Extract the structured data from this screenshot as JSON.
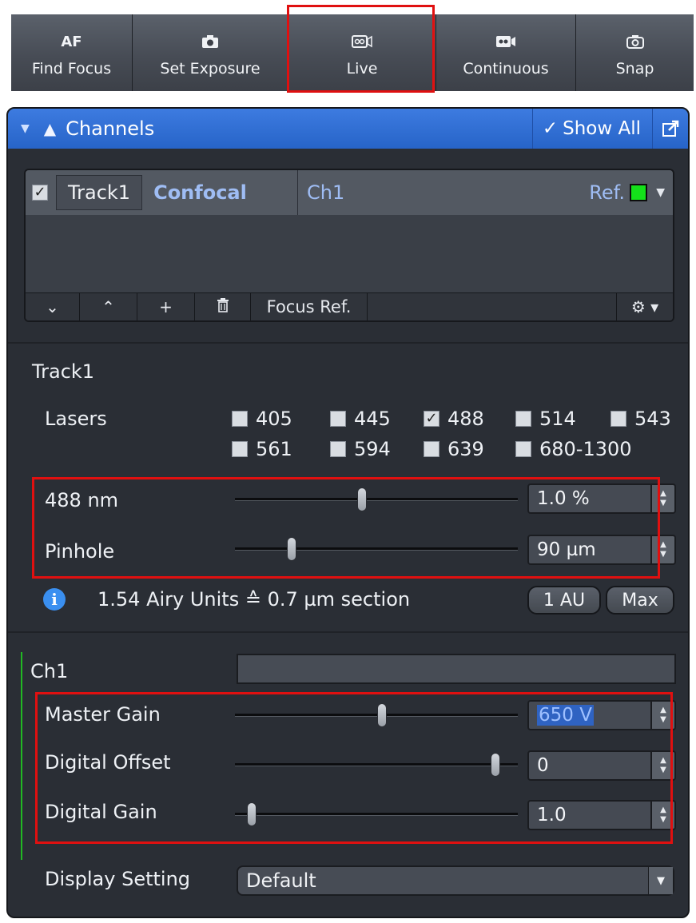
{
  "toolbar": {
    "buttons": [
      {
        "label": "Find Focus",
        "icon": "AF"
      },
      {
        "label": "Set Exposure",
        "icon": "camera-icon"
      },
      {
        "label": "Live",
        "icon": "live-camera-icon"
      },
      {
        "label": "Continuous",
        "icon": "video-camera-icon"
      },
      {
        "label": "Snap",
        "icon": "snap-camera-icon"
      }
    ]
  },
  "channels": {
    "title": "Channels",
    "show_all": "Show All",
    "track": {
      "checked": true,
      "name": "Track1",
      "mode": "Confocal",
      "channel": "Ch1",
      "ref": "Ref.",
      "color": "#14e01a"
    },
    "footer": {
      "down": "˅",
      "up": "˄",
      "add": "+",
      "delete": "🗑",
      "focus_ref": "Focus Ref.",
      "settings": "⚙ ▾"
    }
  },
  "track_settings": {
    "title": "Track1",
    "lasers_label": "Lasers",
    "lasers": [
      {
        "label": "405",
        "checked": false
      },
      {
        "label": "445",
        "checked": false
      },
      {
        "label": "488",
        "checked": true
      },
      {
        "label": "514",
        "checked": false
      },
      {
        "label": "543",
        "checked": false
      },
      {
        "label": "561",
        "checked": false
      },
      {
        "label": "594",
        "checked": false
      },
      {
        "label": "639",
        "checked": false
      },
      {
        "label": "680-1300",
        "checked": false
      }
    ],
    "laser_power": {
      "label": "488 nm",
      "value": "1.0 %"
    },
    "pinhole": {
      "label": "Pinhole",
      "value": "90 µm"
    },
    "airy_info": "1.54 Airy Units ≙ 0.7 µm section",
    "btn_1au": "1 AU",
    "btn_max": "Max"
  },
  "channel_settings": {
    "name": "Ch1",
    "master_gain": {
      "label": "Master Gain",
      "value": "650 V"
    },
    "digital_offset": {
      "label": "Digital Offset",
      "value": "0"
    },
    "digital_gain": {
      "label": "Digital Gain",
      "value": "1.0"
    },
    "display_setting": {
      "label": "Display Setting",
      "value": "Default"
    }
  },
  "colors": {
    "header_blue": "#2f6fd6",
    "highlight_red": "#e01010",
    "channel_green": "#21b823"
  }
}
